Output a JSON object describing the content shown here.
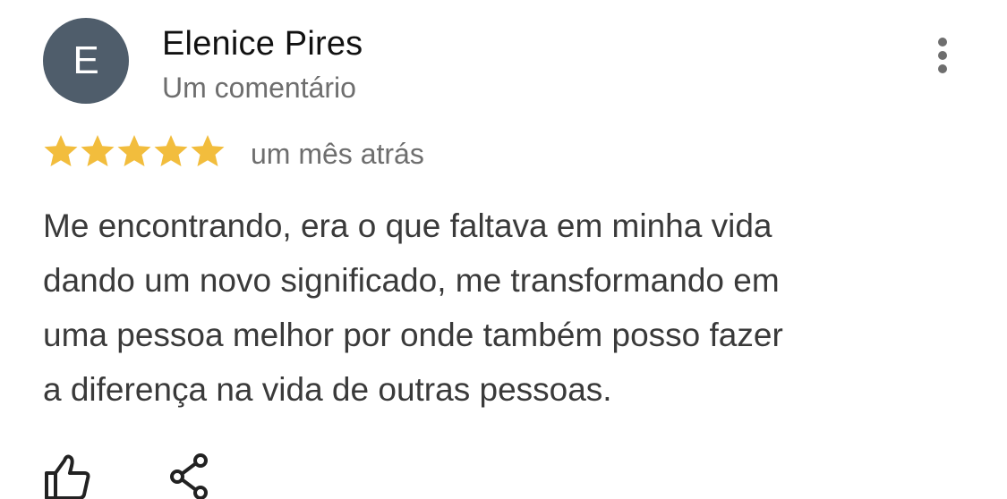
{
  "review": {
    "avatar_letter": "E",
    "author_name": "Elenice Pires",
    "author_meta": "Um comentário",
    "rating": 5,
    "rating_max": 5,
    "date": "um mês atrás",
    "text": "Me encontrando,  era o que faltava em minha vida\ndando um novo significado, me transformando em\numa pessoa melhor por onde também posso fazer\na diferença na vida de outras pessoas."
  },
  "icons": {
    "more": "more-vert-icon",
    "like": "thumb-up-icon",
    "share": "share-icon",
    "star": "star-icon"
  },
  "colors": {
    "avatar_bg": "#4f5d6b",
    "star": "#f2bd3d",
    "secondary_text": "#6e6e6e",
    "body_text": "#3a3a3a"
  }
}
